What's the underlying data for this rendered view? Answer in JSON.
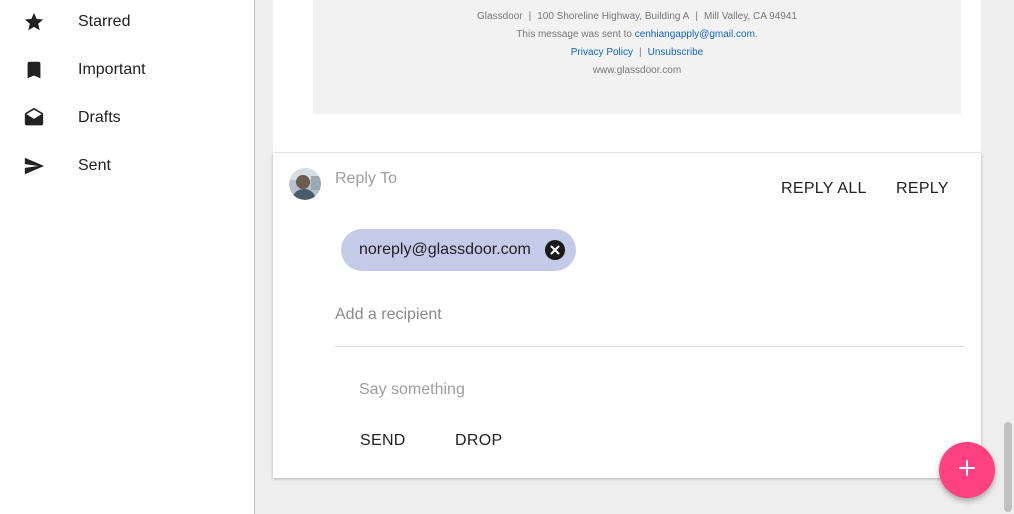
{
  "sidebar": {
    "items": [
      {
        "label": "Starred",
        "icon": "star-icon"
      },
      {
        "label": "Important",
        "icon": "bookmark-icon"
      },
      {
        "label": "Drafts",
        "icon": "drafts-icon"
      },
      {
        "label": "Sent",
        "icon": "send-icon"
      }
    ]
  },
  "email_footer": {
    "address_parts": [
      "Glassdoor",
      "100 Shoreline Highway, Building A",
      "Mill Valley, CA 94941"
    ],
    "sent_to_prefix": "This message was sent to ",
    "sent_to_email": "cenhiangapply@gmail.com",
    "sent_to_suffix": ".",
    "privacy_link": "Privacy Policy",
    "unsubscribe_link": "Unsubscribe",
    "website": "www.glassdoor.com"
  },
  "reply": {
    "reply_to_label": "Reply To",
    "reply_all_button": "REPLY ALL",
    "reply_button": "REPLY",
    "recipient_chip": "noreply@glassdoor.com",
    "add_recipient_placeholder": "Add a recipient",
    "message_placeholder": "Say something",
    "send_button": "SEND",
    "drop_button": "DROP"
  },
  "colors": {
    "chip_background": "#c5cae9",
    "fab": "#ff4081",
    "link": "#1565c0"
  },
  "fab_icon": "plus-icon"
}
